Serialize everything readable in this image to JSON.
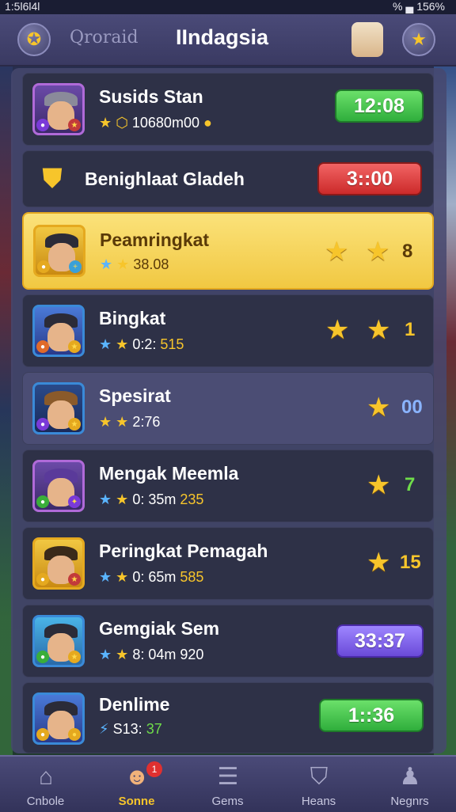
{
  "status": {
    "time": "1:5l6l4l",
    "right": "% ▄ 156%"
  },
  "header": {
    "left_label": "Qroraid",
    "title": "IIndagsia"
  },
  "rows": [
    {
      "name": "Susids Stan",
      "sub_text": "10680m00",
      "timer": "12:08"
    },
    {
      "name": "Benighlaat Gladeh",
      "timer": "3::00"
    },
    {
      "name": "Peamringkat",
      "sub_text": "38.08",
      "rank": "8"
    },
    {
      "name": "Bingkat",
      "sub_text_w": "0:2:",
      "sub_text_g": "515",
      "rank": "1"
    },
    {
      "name": "Spesirat",
      "sub_text": "2:76",
      "rank": "00"
    },
    {
      "name": "Mengak Meemla",
      "sub_text_w": "0: 35m",
      "sub_text_g": "235",
      "rank": "7"
    },
    {
      "name": "Peringkat Pemagah",
      "sub_text_w": "0: 65m",
      "sub_text_g": "585",
      "rank": "15"
    },
    {
      "name": "Gemgiak Sem",
      "sub_text_w": "8: 04m",
      "sub_text_g": "920",
      "timer": "33:37"
    },
    {
      "name": "Denlime",
      "sub_text_w": "S13:",
      "sub_text_g": "37",
      "timer": "1::36"
    }
  ],
  "nav": [
    {
      "label": "Cnbole",
      "icon": "home-icon"
    },
    {
      "label": "Sonne",
      "icon": "profile-icon",
      "badge": "1"
    },
    {
      "label": "Gems",
      "icon": "list-icon"
    },
    {
      "label": "Heans",
      "icon": "team-icon"
    },
    {
      "label": "Negnrs",
      "icon": "user-icon"
    }
  ],
  "colors": {
    "accent_gold": "#f7c52b",
    "timer_green": "#2fae3c",
    "timer_red": "#cc2a2a",
    "timer_purple": "#6a4ad8"
  }
}
